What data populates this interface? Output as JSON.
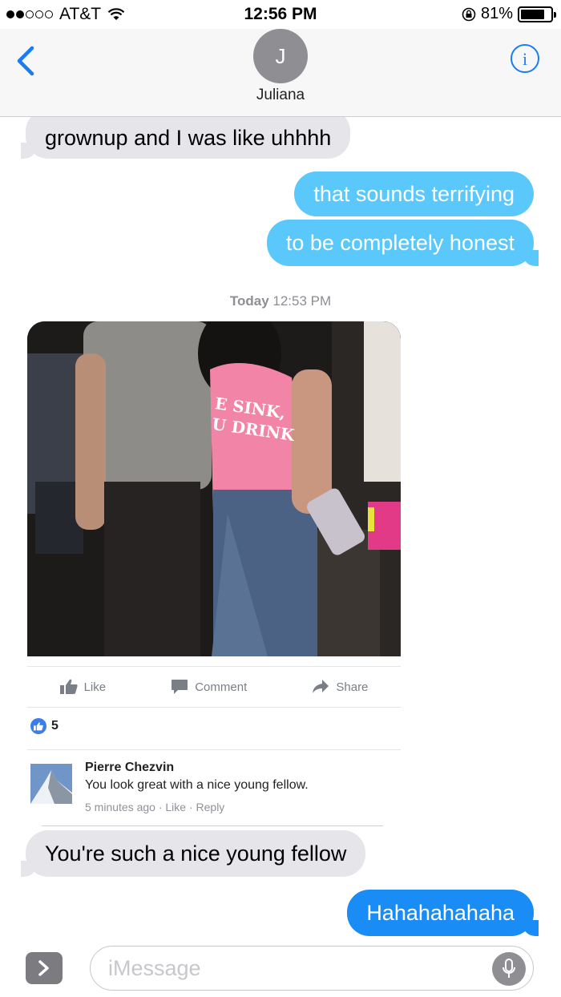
{
  "status_bar": {
    "carrier": "AT&T",
    "time": "12:56 PM",
    "battery_percent": "81%",
    "battery_level": 0.81,
    "signal_bars_filled": 2,
    "signal_bars_total": 5
  },
  "header": {
    "avatar_initial": "J",
    "contact_name": "Juliana"
  },
  "messages": [
    {
      "type": "received",
      "text": "grownup and I was like uhhhh"
    },
    {
      "type": "sent",
      "text": "that sounds terrifying"
    },
    {
      "type": "sent",
      "text": "to be completely honest"
    }
  ],
  "timestamp": {
    "day": "Today",
    "time": "12:53 PM"
  },
  "shared_post": {
    "shirt_text_line1": "E SINK,",
    "shirt_text_line2": "U DRINK",
    "actions": {
      "like": "Like",
      "comment": "Comment",
      "share": "Share"
    },
    "like_count": "5",
    "comment": {
      "author": "Pierre Chezvin",
      "text": "You look great with a nice young fellow.",
      "meta": "5 minutes ago · Like · Reply"
    }
  },
  "messages_after": [
    {
      "type": "received",
      "text": "You're such a nice young fellow"
    },
    {
      "type": "sent",
      "text": "Hahahahahaha"
    }
  ],
  "input": {
    "placeholder": "iMessage"
  },
  "colors": {
    "received_bubble": "#e5e5ea",
    "sent_sms_bubble": "#5ac8fa",
    "sent_imessage_bubble": "#1a8cf5",
    "ios_blue": "#1a7cf5",
    "fb_like_blue": "#3b7de9"
  },
  "icons": [
    "wifi-icon",
    "lock-rotation-icon",
    "battery-icon",
    "back-chevron-icon",
    "info-icon",
    "thumbs-up-icon",
    "comment-icon",
    "share-arrow-icon",
    "apps-chevron-icon",
    "microphone-icon"
  ]
}
